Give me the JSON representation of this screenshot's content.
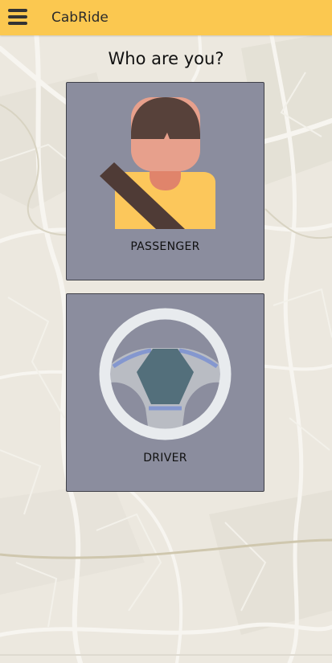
{
  "app_bar": {
    "title": "CabRide",
    "menu_icon": "hamburger-menu-icon"
  },
  "page": {
    "heading": "Who are you?"
  },
  "roles": [
    {
      "label": "PASSENGER",
      "icon": "passenger-icon"
    },
    {
      "label": "DRIVER",
      "icon": "steering-wheel-icon"
    }
  ],
  "colors": {
    "app_bar": "#fbc850",
    "card_background": "#8b8d9e",
    "map_background": "#ece8df"
  }
}
